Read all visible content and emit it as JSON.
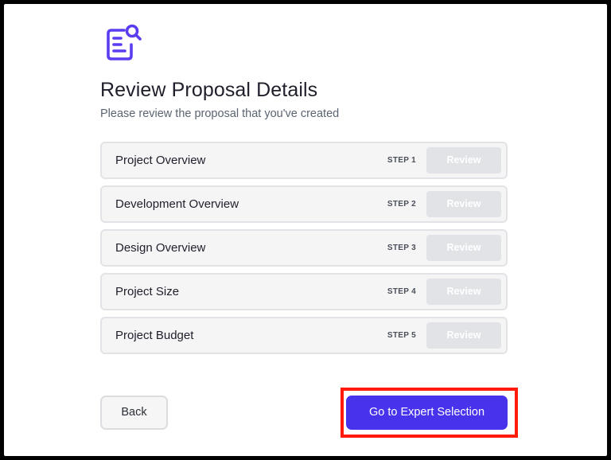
{
  "header": {
    "icon": "document-search-icon",
    "title": "Review Proposal Details",
    "subtitle": "Please review the proposal that you've created"
  },
  "steps": [
    {
      "label": "Project Overview",
      "tag": "STEP 1",
      "action": "Review"
    },
    {
      "label": "Development Overview",
      "tag": "STEP 2",
      "action": "Review"
    },
    {
      "label": "Design Overview",
      "tag": "STEP 3",
      "action": "Review"
    },
    {
      "label": "Project Size",
      "tag": "STEP 4",
      "action": "Review"
    },
    {
      "label": "Project Budget",
      "tag": "STEP 5",
      "action": "Review"
    }
  ],
  "footer": {
    "back_label": "Back",
    "next_label": "Go to Expert Selection"
  },
  "colors": {
    "accent": "#4733eb",
    "highlight": "#ff1a0a"
  }
}
